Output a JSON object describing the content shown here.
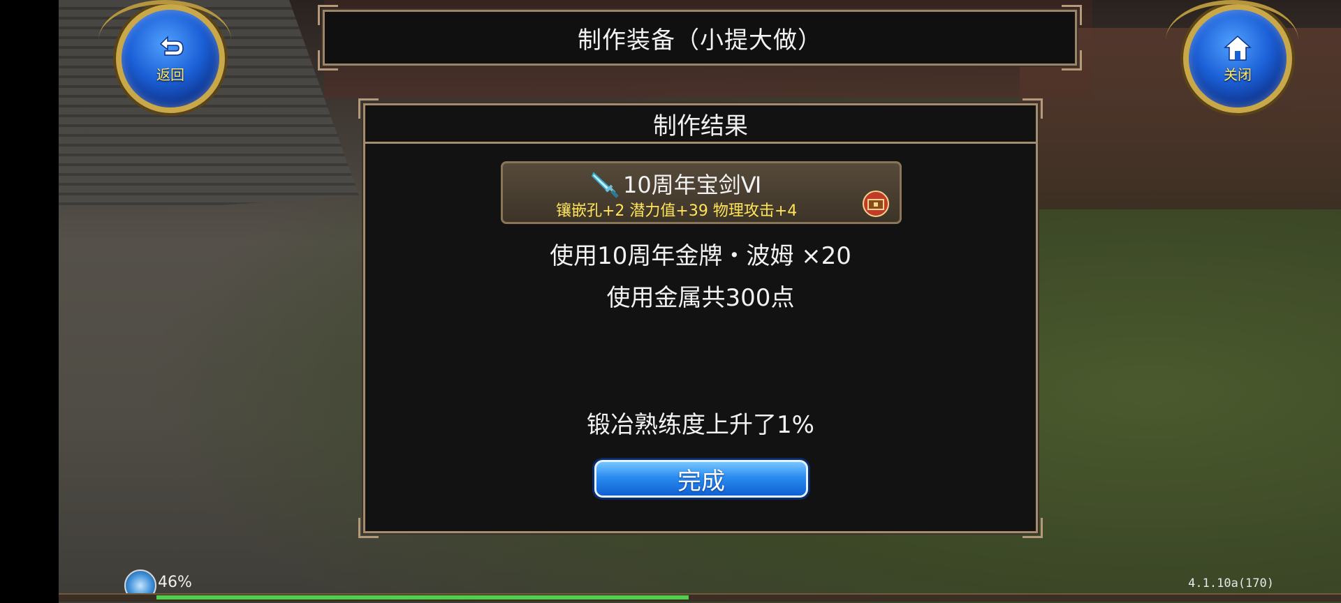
{
  "header": {
    "title": "制作装备（小提大做）"
  },
  "nav": {
    "back_label": "返回",
    "close_label": "关闭"
  },
  "result_panel": {
    "title": "制作结果",
    "item": {
      "icon": "sword-icon",
      "name": "10周年宝剑Ⅵ",
      "stats": "镶嵌孔+2  潜力值+39  物理攻击+4",
      "badge_icon": "chest-icon"
    },
    "usage_line_1": "使用10周年金牌・波姆 ×20",
    "usage_line_2": "使用金属共300点",
    "proficiency": "锻冶熟练度上升了1%",
    "done_label": "完成"
  },
  "status": {
    "percent_text": "46%",
    "progress": 0.46,
    "version": "4.1.10a(170)"
  },
  "colors": {
    "accent_gold": "#c9a84a",
    "stat_yellow": "#ffe45a",
    "button_blue": "#1b6fe0",
    "progress_green": "#4fd04a"
  }
}
